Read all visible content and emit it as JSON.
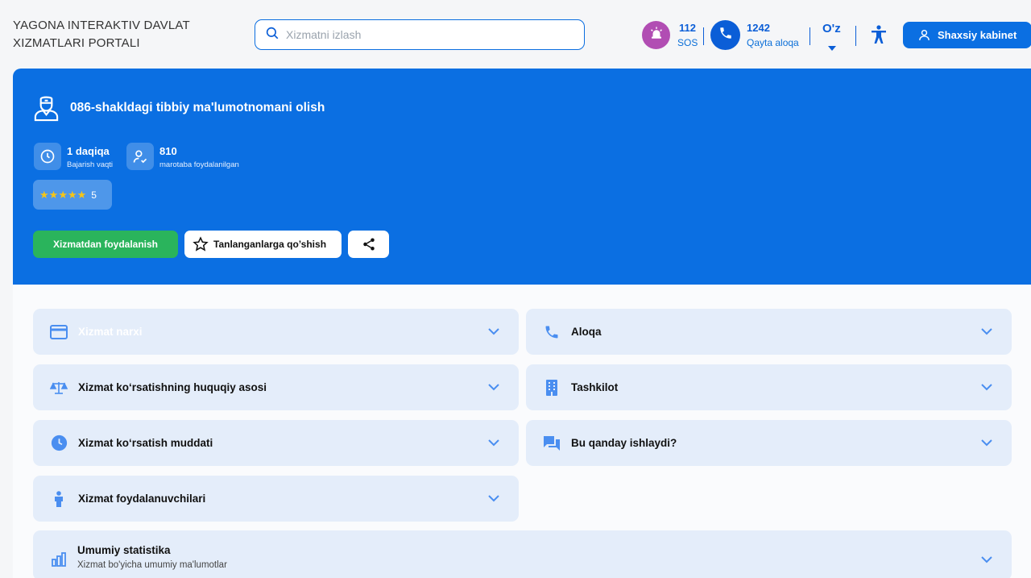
{
  "header": {
    "logo_line1": "YAGONA INTERAKTIV DAVLAT",
    "logo_line2": "XIZMATLARI PORTALI",
    "search_placeholder": "Xizmatni izlash",
    "sos_number": "112",
    "sos_label": "SOS",
    "callback_number": "1242",
    "callback_label": "Qayta aloqa",
    "language": "O'z",
    "cabinet_label": "Shaxsiy kabinet"
  },
  "service": {
    "title": "086-shakldagi tibbiy ma'lumotnomani olish",
    "duration_value": "1 daqiqa",
    "duration_label": "Bajarish vaqti",
    "usage_value": "810",
    "usage_label": "marotaba foydalanilgan",
    "rating_value": "5",
    "rating_stars": 5,
    "use_button": "Xizmatdan foydalanish",
    "favorite_button": "Tanlanganlarga qo’shish"
  },
  "accordions": {
    "price": "Xizmat narxi",
    "contact": "Aloqa",
    "legal": "Xizmat ko‘rsatishning huquqiy asosi",
    "org": "Tashkilot",
    "duration": "Xizmat ko‘rsatish muddati",
    "how": "Bu qanday ishlaydi?",
    "users": "Xizmat foydalanuvchilari",
    "stats_title": "Umumiy statistika",
    "stats_sub": "Xizmat bo'yicha umumiy ma'lumotlar"
  },
  "colors": {
    "primary": "#0b6fe2",
    "green": "#2ab45c",
    "sos": "#b14db3",
    "accordion_bg": "#e4edfa"
  }
}
